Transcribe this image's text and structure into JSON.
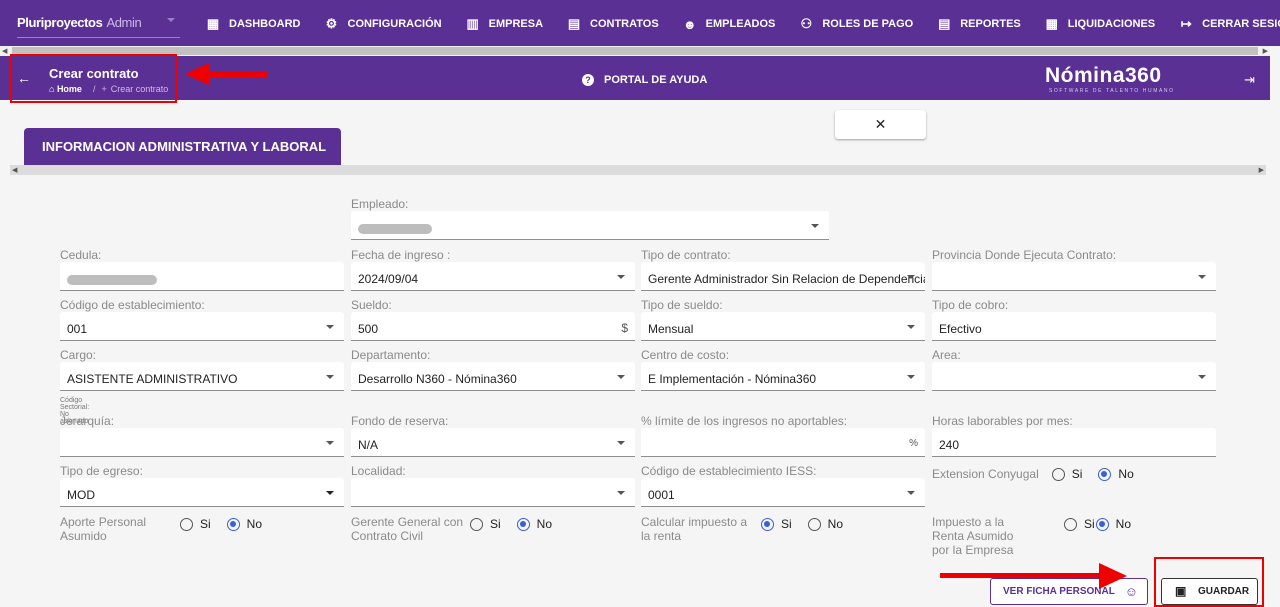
{
  "topbar": {
    "brand": "Pluriproyectos",
    "brand_user": "Admin",
    "nav": [
      {
        "icon": "dashboard-icon",
        "glyph": "▦",
        "label": "DASHBOARD"
      },
      {
        "icon": "gear-icon",
        "glyph": "⚙",
        "label": "CONFIGURACIÓN"
      },
      {
        "icon": "building-icon",
        "glyph": "▥",
        "label": "EMPRESA"
      },
      {
        "icon": "contract-icon",
        "glyph": "▤",
        "label": "CONTRATOS"
      },
      {
        "icon": "employee-face-icon",
        "glyph": "☻",
        "label": "EMPLEADOS"
      },
      {
        "icon": "group-icon",
        "glyph": "⚇",
        "label": "ROLES DE PAGO"
      },
      {
        "icon": "report-icon",
        "glyph": "▤",
        "label": "REPORTES"
      },
      {
        "icon": "list-icon",
        "glyph": "▦",
        "label": "LIQUIDACIONES"
      },
      {
        "icon": "logout-icon",
        "glyph": "↦",
        "label": "CERRAR SESIÓN"
      }
    ]
  },
  "header": {
    "title": "Crear contrato",
    "breadcrumb_home": "Home",
    "breadcrumb_current": "Crear contrato",
    "help_label": "PORTAL DE AYUDA",
    "logo": "Nómina360",
    "logo_sub": "SOFTWARE DE TALENTO HUMANO"
  },
  "tab": {
    "label": "INFORMACION ADMINISTRATIVA Y LABORAL"
  },
  "form": {
    "empleado": {
      "label": "Empleado:",
      "value": ""
    },
    "clear_button": "✕",
    "cedula": {
      "label": "Cedula:",
      "value": ""
    },
    "fecha_ingreso": {
      "label": "Fecha de ingreso :",
      "value": "2024/09/04"
    },
    "tipo_contrato": {
      "label": "Tipo de contrato:",
      "value": "Gerente Administrador Sin Relacion de Dependencia"
    },
    "provincia": {
      "label": "Provincia Donde Ejecuta Contrato:",
      "value": ""
    },
    "codigo_establecimiento": {
      "label": "Código de establecimiento:",
      "value": "001"
    },
    "sueldo": {
      "label": "Sueldo:",
      "value": "500",
      "suffix": "$"
    },
    "tipo_sueldo": {
      "label": "Tipo de sueldo:",
      "value": "Mensual"
    },
    "tipo_cobro": {
      "label": "Tipo de cobro:",
      "value": "Efectivo"
    },
    "cargo": {
      "label": "Cargo:",
      "value": "ASISTENTE ADMINISTRATIVO",
      "note": "Código Sectorial: No asignado"
    },
    "departamento": {
      "label": "Departamento:",
      "value": "Desarrollo N360 - Nómina360"
    },
    "centro_costo": {
      "label": "Centro de costo:",
      "value": "E Implementación - Nómina360"
    },
    "area": {
      "label": "Area:",
      "value": ""
    },
    "jerarquia": {
      "label": "Jerarquía:",
      "value": ""
    },
    "fondo_reserva": {
      "label": "Fondo de reserva:",
      "value": "N/A"
    },
    "limite_ingresos": {
      "label": "% límite de los ingresos no aportables:",
      "value": "",
      "suffix": "%"
    },
    "horas_laborables": {
      "label": "Horas laborables por mes:",
      "value": "240"
    },
    "tipo_egreso": {
      "label": "Tipo de egreso:",
      "value": "MOD"
    },
    "localidad": {
      "label": "Localidad:",
      "value": ""
    },
    "codigo_iess": {
      "label": "Código de establecimiento IESS:",
      "value": "0001"
    },
    "extension_conyugal": {
      "label": "Extension Conyugal",
      "yes": "Si",
      "no": "No",
      "selected": "No"
    },
    "aporte_personal": {
      "label": "Aporte Personal Asumido",
      "yes": "Si",
      "no": "No",
      "selected": "No"
    },
    "gerente_general": {
      "label": "Gerente General con Contrato Civil",
      "yes": "Si",
      "no": "No",
      "selected": "No"
    },
    "impuesto_renta": {
      "label": "Calcular impuesto a la renta",
      "yes": "Si",
      "no": "No",
      "selected": "Si"
    },
    "impuesto_asumido": {
      "label": "Impuesto a la Renta Asumido por la Empresa",
      "yes": "Si",
      "no": "No",
      "selected": "No"
    }
  },
  "actions": {
    "ver_ficha": "VER FICHA PERSONAL",
    "guardar": "GUARDAR"
  },
  "colors": {
    "primary": "#5b3095",
    "radio": "#3a5fd6",
    "annotation": "#ee0000"
  }
}
